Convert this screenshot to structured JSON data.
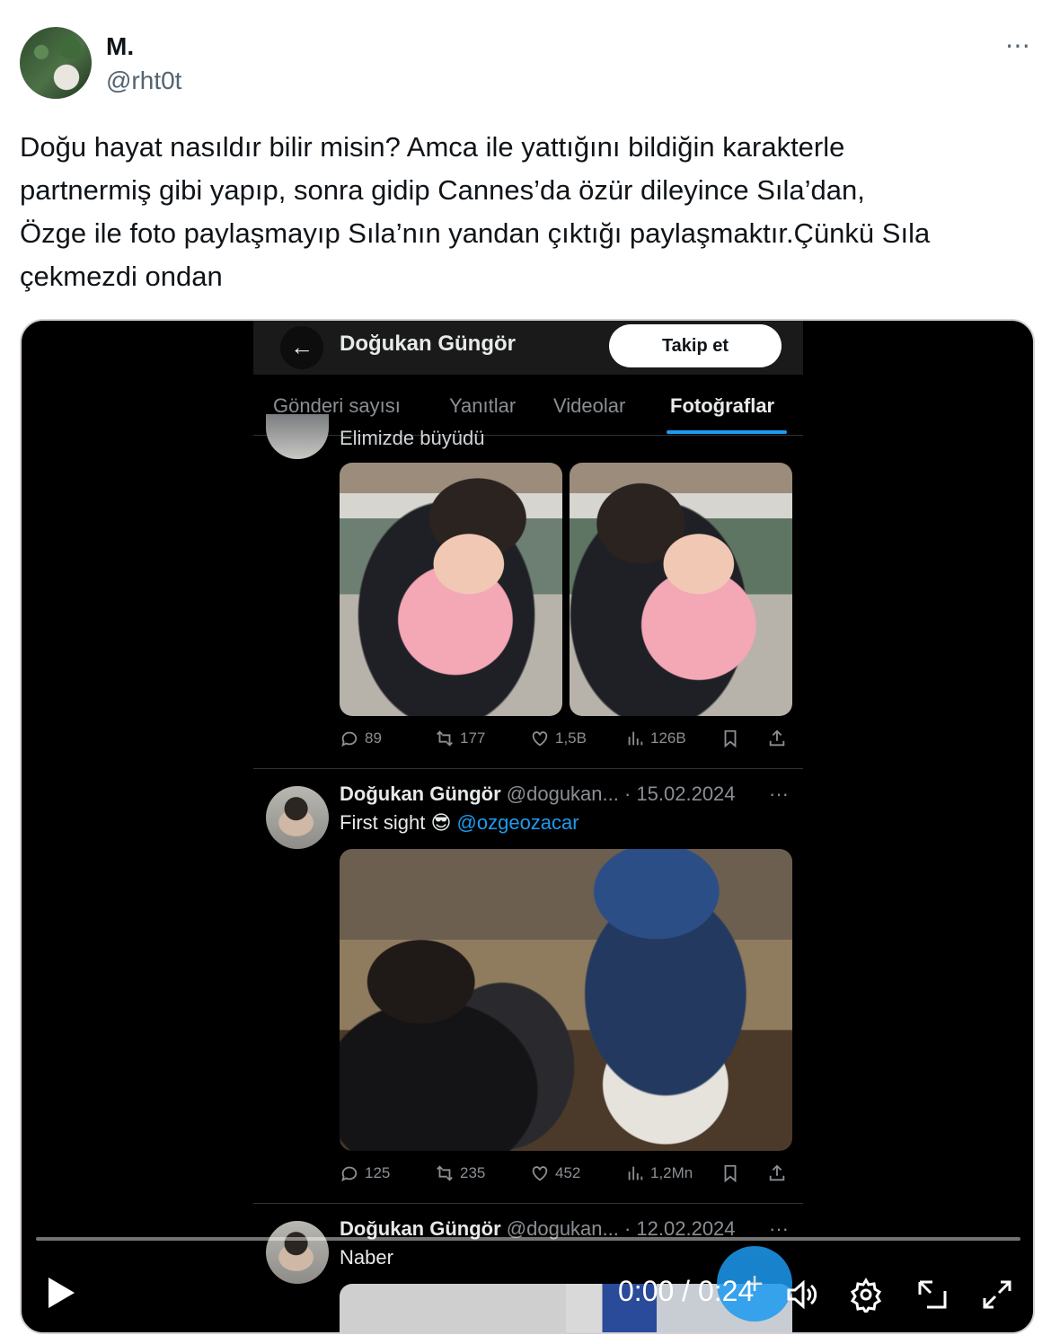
{
  "tweet": {
    "display_name": "M.",
    "handle": "@rht0t",
    "more_icon": "⋯",
    "text_lines": [
      "Doğu hayat nasıldır bilir misin? Amca ile  yattığını bildiğin karakterle",
      "partnermiş gibi yapıp, sonra gidip Cannes’da özür dileyince Sıla’dan,",
      "Özge ile foto paylaşmayıp Sıla’nın yandan çıktığı paylaşmaktır.Çünkü Sıla",
      "çekmezdi ondan"
    ]
  },
  "video": {
    "profile": {
      "title": "Doğukan Güngör",
      "follow_label": "Takip et",
      "tabs": [
        "Gönderi sayısı",
        "Yanıtlar",
        "Videolar",
        "Fotoğraflar"
      ],
      "active_tab": "Fotoğraflar"
    },
    "cut_text": "Elimizde büyüdü",
    "post1_stats": {
      "replies": "89",
      "reposts": "177",
      "likes": "1,5B",
      "views": "126B"
    },
    "post2": {
      "name": "Doğukan Güngör",
      "meta": "@dogukan... · 15.02.2024",
      "more": "···",
      "text": "First sight 😎",
      "mention": "@ozgeozacar",
      "stats": {
        "replies": "125",
        "reposts": "235",
        "likes": "452",
        "views": "1,2Mn"
      }
    },
    "post3": {
      "name": "Doğukan Güngör",
      "meta": "@dogukan... · 12.02.2024",
      "more": "···",
      "text": "Naber"
    },
    "controls": {
      "time": "0:00 / 0:24",
      "fab_label": "+",
      "progress_fraction": 0.0
    }
  },
  "colors": {
    "accent": "#1d9bf0",
    "text_primary": "#0f1419",
    "text_secondary": "#536471",
    "video_bg": "#000000"
  }
}
